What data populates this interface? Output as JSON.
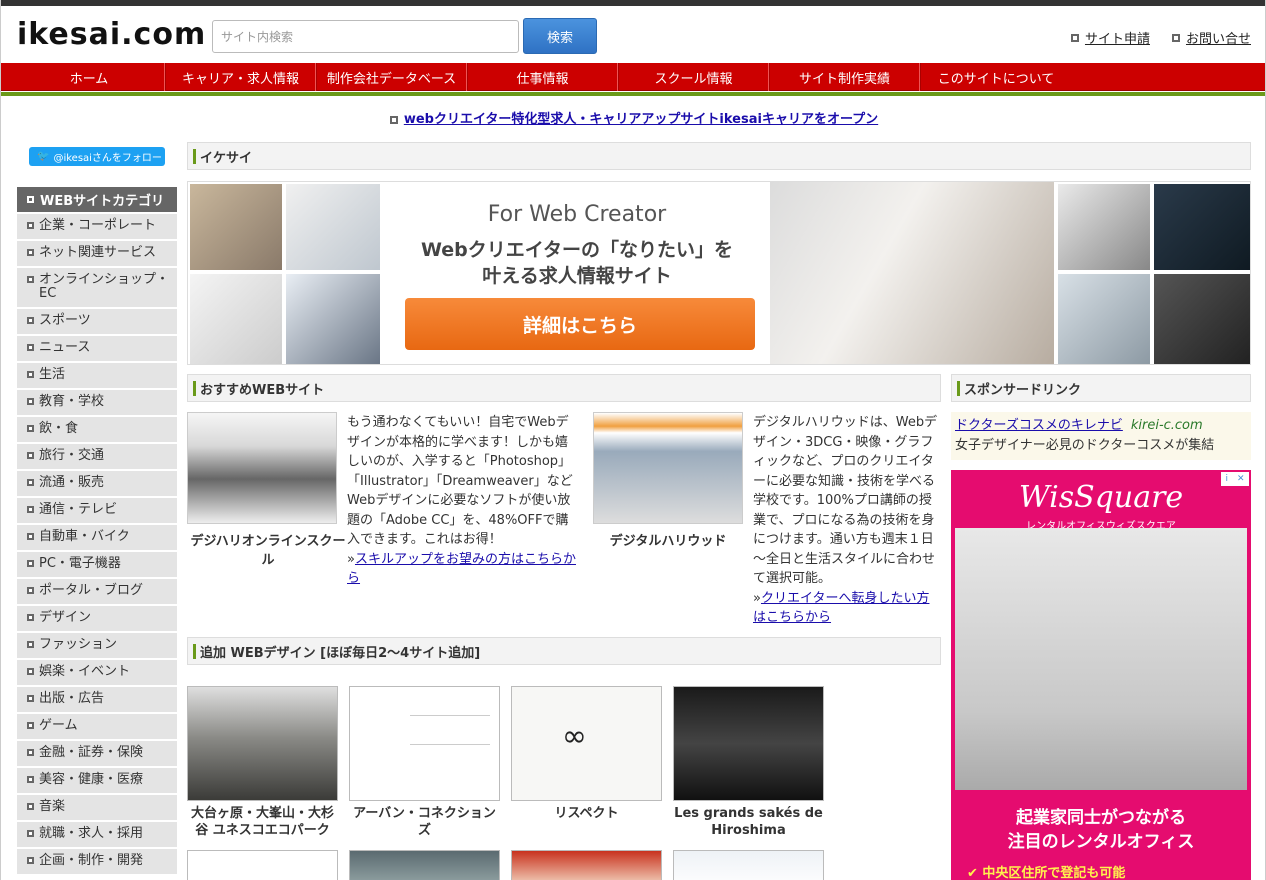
{
  "header": {
    "logo": "ikesai.com",
    "search_placeholder": "サイト内検索",
    "search_button": "検索",
    "links": [
      "サイト申請",
      "お問い合せ"
    ]
  },
  "nav": [
    "ホーム",
    "キャリア・求人情報",
    "制作会社データベース",
    "仕事情報",
    "スクール情報",
    "サイト制作実績",
    "このサイトについて"
  ],
  "announcement": "webクリエイター特化型求人・キャリアアップサイトikesaiキャリアをオープン",
  "twitter_follow": "@ikesaiさんをフォロー",
  "sidebar": {
    "heading": "WEBサイトカテゴリ",
    "items": [
      "企業・コーポレート",
      "ネット関連サービス",
      "オンラインショップ・EC",
      "スポーツ",
      "ニュース",
      "生活",
      "教育・学校",
      "飲・食",
      "旅行・交通",
      "流通・販売",
      "通信・テレビ",
      "自動車・バイク",
      "PC・電子機器",
      "ポータル・ブログ",
      "デザイン",
      "ファッション",
      "娯楽・イベント",
      "出版・広告",
      "ゲーム",
      "金融・証券・保険",
      "美容・健康・医療",
      "音楽",
      "就職・求人・採用",
      "企画・制作・開発"
    ]
  },
  "section_ikesai": "イケサイ",
  "banner": {
    "title": "For Web Creator",
    "subtitle_line1": "Webクリエイターの「なりたい」を",
    "subtitle_line2": "叶える求人情報サイト",
    "button": "詳細はこちら"
  },
  "recommended": {
    "heading": "おすすめWEBサイト",
    "items": [
      {
        "name": "デジハリオンラインスクール",
        "text": "もう通わなくてもいい！自宅でWebデザインが本格的に学べます！しかも嬉しいのが、入学すると「Photoshop」「Illustrator」「Dreamweaver」などWebデザインに必要なソフトが使い放題の「Adobe CC」を、48%OFFで購入できます。これはお得！",
        "link_prefix": "»",
        "link": "スキルアップをお望みの方はこちらから"
      },
      {
        "name": "デジタルハリウッド",
        "text": "デジタルハリウッドは、Webデザイン・3DCG・映像・グラフィックなど、プロのクリエイターに必要な知識・技術を学べる学校です。100%プロ講師の授業で、プロになる為の技術を身につけます。通い方も週末１日～全日と生活スタイルに合わせて選択可能。",
        "link_prefix": "»",
        "link": "クリエイターへ転身したい方はこちらから"
      }
    ]
  },
  "sponsored": {
    "heading": "スポンサードリンク",
    "link": "ドクターズコスメのキレナビ",
    "domain": "kirei-c.com",
    "desc": "女子デザイナー必見のドクターコスメが集結"
  },
  "ad": {
    "logo": "WisSquare",
    "subtitle": "レンタルオフィスウィズスクエア",
    "line1": "起業家同士がつながる",
    "line2": "注目のレンタルオフィス",
    "check": "✔ 中央区住所で登記も可能"
  },
  "added": {
    "heading": "追加 WEBデザイン [ほぼ毎日2〜4サイト追加]",
    "items": [
      "大台ヶ原・大峯山・大杉谷 ユネスコエコパーク",
      "アーバン・コネクションズ",
      "リスペクト",
      "Les grands sakés de Hiroshima"
    ]
  },
  "colors": {
    "nav_red": "#cc0000",
    "accent_green": "#6a9a1a",
    "banner_orange": "#e86812",
    "ad_pink": "#e50c6f",
    "link_blue": "#1a0dab"
  }
}
